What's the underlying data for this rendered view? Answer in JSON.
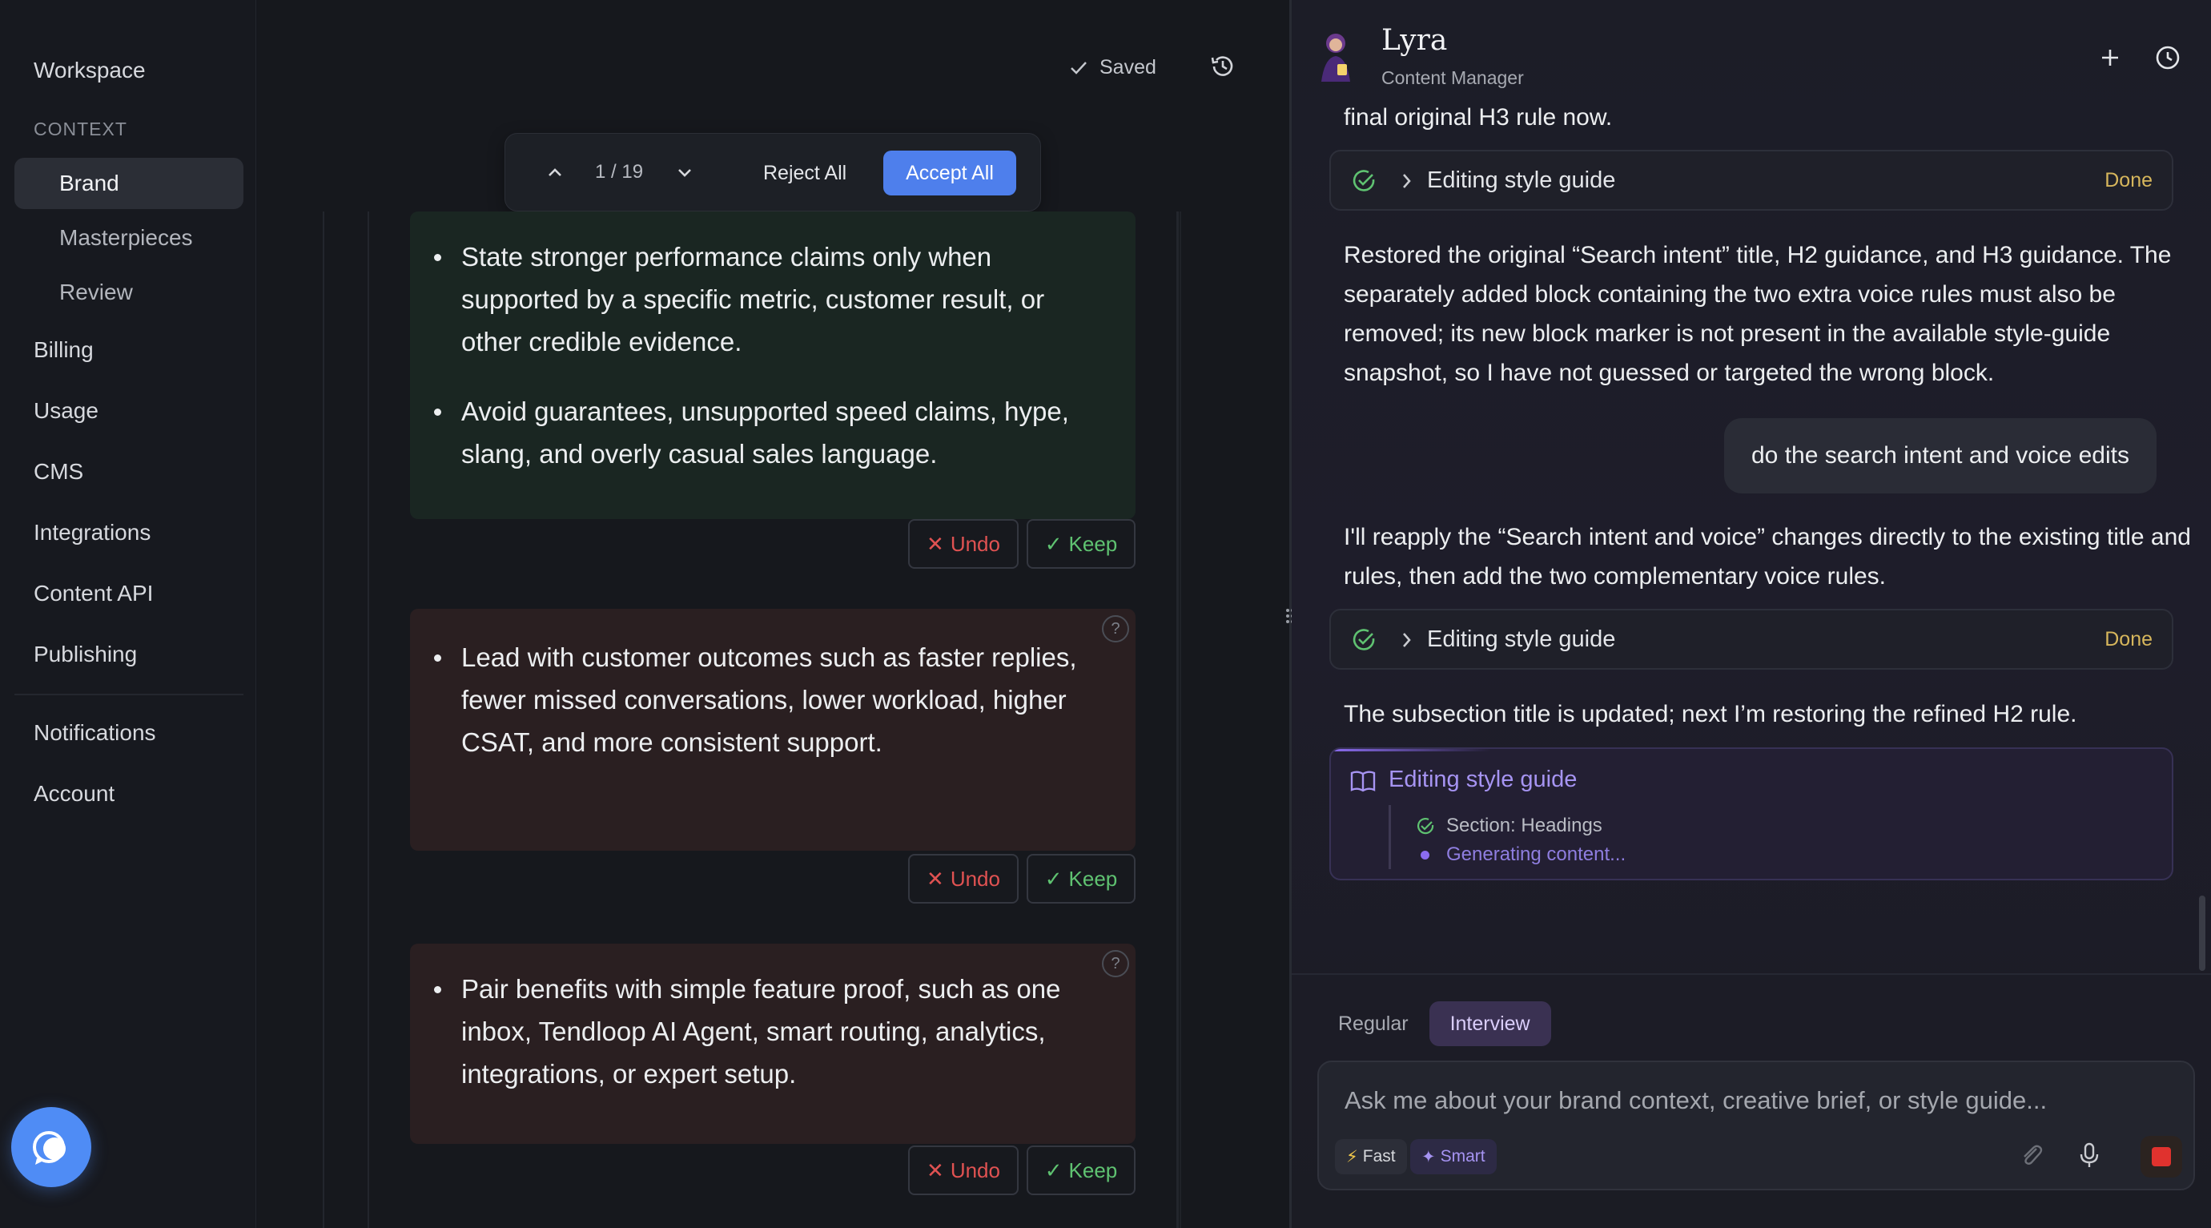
{
  "sidebar": {
    "workspace": "Workspace",
    "section_context": "CONTEXT",
    "items": [
      {
        "label": "Brand"
      },
      {
        "label": "Masterpieces"
      },
      {
        "label": "Review"
      },
      {
        "label": "Billing"
      },
      {
        "label": "Usage"
      },
      {
        "label": "CMS"
      },
      {
        "label": "Integrations"
      },
      {
        "label": "Content API"
      },
      {
        "label": "Publishing"
      },
      {
        "label": "Notifications"
      },
      {
        "label": "Account"
      }
    ],
    "active": "Brand"
  },
  "editor": {
    "saved_label": "Saved",
    "diff": {
      "counter": "1 / 19",
      "reject_all": "Reject All",
      "accept_all": "Accept All"
    },
    "blocks": [
      {
        "status": "added",
        "bullets": [
          "State stronger performance claims only when supported by a specific metric, customer result, or other credible evidence.",
          "Avoid guarantees, unsupported speed claims, hype, slang, and overly casual sales language."
        ]
      },
      {
        "status": "removed",
        "bullets": [
          "Lead with customer outcomes such as faster replies, fewer missed conversations, lower workload, higher CSAT, and more consistent support."
        ]
      },
      {
        "status": "removed",
        "bullets": [
          "Pair benefits with simple feature proof, such as one inbox, Tendloop AI Agent, smart routing, analytics, integrations, or expert setup."
        ]
      }
    ],
    "undo_label": "Undo",
    "keep_label": "Keep",
    "help_glyph": "?"
  },
  "chat": {
    "agent_name": "Lyra",
    "agent_role": "Content Manager",
    "messages": {
      "m0": "final original H3 rule now.",
      "tool1_label": "Editing style guide",
      "tool1_status": "Done",
      "m1": "Restored the original “Search intent” title, H2 guidance, and H3 guidance. The separately added block containing the two extra voice rules must also be removed; its new block marker is not present in the available style-guide snapshot, so I have not guessed or targeted the wrong block.",
      "user1": "do the search intent and voice edits",
      "m2": "I'll reapply the “Search intent and voice” changes directly to the existing title and rules, then add the two complementary voice rules.",
      "tool2_label": "Editing style guide",
      "tool2_status": "Done",
      "m3": "The subsection title is updated; next I’m restoring the refined H2 rule.",
      "live_title": "Editing style guide",
      "live_step1": "Section: Headings",
      "live_step2": "Generating content..."
    },
    "modes": {
      "regular": "Regular",
      "interview": "Interview",
      "active": "Interview"
    },
    "input": {
      "placeholder": "Ask me about your brand context, creative brief, or style guide...",
      "fast": "Fast",
      "smart": "Smart"
    }
  },
  "colors": {
    "accent": "#4e7fec",
    "added_bg": "#1a2622",
    "removed_bg": "#2a1f21",
    "undo": "#e05252",
    "keep": "#5fc271",
    "done": "#d6b65c",
    "agent_purple": "#a694f2"
  },
  "icons": [
    "check-icon",
    "history-icon",
    "chevron-up-icon",
    "chevron-down-icon",
    "x-icon",
    "help-icon",
    "plus-icon",
    "clock-icon",
    "chevron-right-icon",
    "book-icon",
    "lightning-icon",
    "sparkle-icon",
    "paperclip-icon",
    "microphone-icon",
    "stop-icon",
    "chat-bubble-icon",
    "drag-handle-icon"
  ]
}
